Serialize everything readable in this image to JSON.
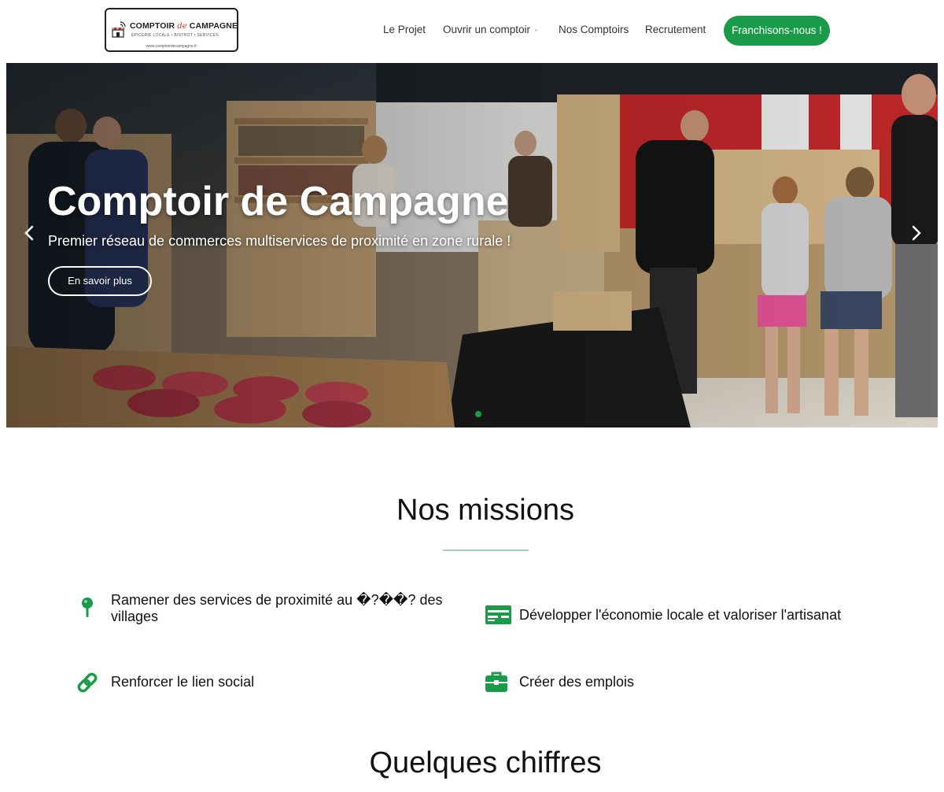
{
  "header": {
    "logo": {
      "name_part1": "COMPTOIR",
      "name_de": "de",
      "name_part2": "CAMPAGNE",
      "tagline": "ÉPICERIE LOCALE • BISTROT • SERVICES",
      "url": "www.comptoirdecampagne.fr"
    },
    "nav": [
      {
        "label": "Le Projet"
      },
      {
        "label": "Ouvrir un comptoir",
        "caret": "▫"
      },
      {
        "label": "Nos Comptoirs"
      },
      {
        "label": "Recrutement"
      }
    ],
    "cta_label": "Franchisons-nous !"
  },
  "hero": {
    "title": "Comptoir de Campagne",
    "subtitle": "Premier réseau de commerces multiservices de proximité en zone rurale !",
    "button_label": "En savoir plus",
    "prev_icon": "chevron-left-icon",
    "next_icon": "chevron-right-icon",
    "active_slide": 1,
    "slide_count": 1
  },
  "missions": {
    "title": "Nos missions",
    "accent_color": "#1a9b4a",
    "items": [
      {
        "icon": "map-pin-icon",
        "text": "Ramener des services de proximité au �?��? des villages"
      },
      {
        "icon": "money-bill-icon",
        "text": "Développer l'économie locale et valoriser l'artisanat"
      },
      {
        "icon": "link-icon",
        "text": "Renforcer le lien social"
      },
      {
        "icon": "briefcase-icon",
        "text": "Créer des emplois"
      }
    ]
  },
  "figures": {
    "title": "Quelques chiffres"
  }
}
